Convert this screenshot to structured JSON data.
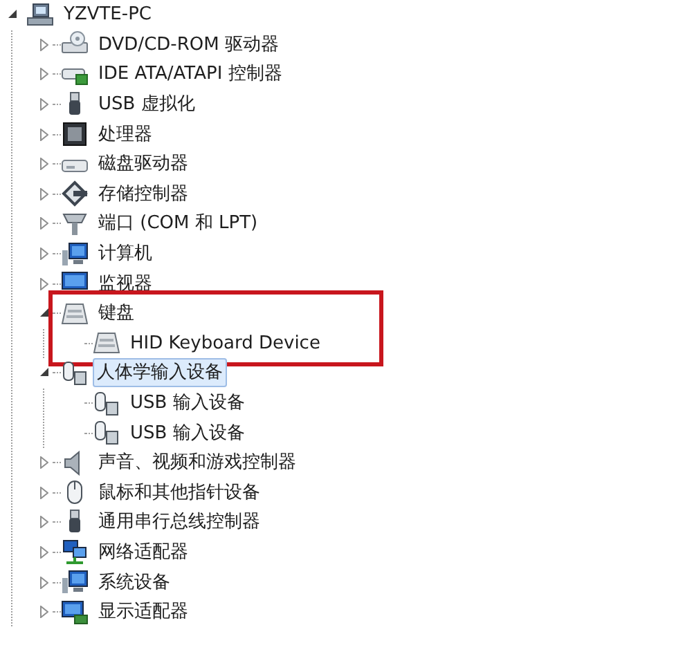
{
  "tree": [
    {
      "label": "YZVTE-PC",
      "expanded": true,
      "selected": false,
      "children": [
        {
          "label": "DVD/CD-ROM 驱动器",
          "expanded": false,
          "selected": false
        },
        {
          "label": "IDE ATA/ATAPI 控制器",
          "expanded": false,
          "selected": false
        },
        {
          "label": "USB 虚拟化",
          "expanded": false,
          "selected": false
        },
        {
          "label": "处理器",
          "expanded": false,
          "selected": false
        },
        {
          "label": "磁盘驱动器",
          "expanded": false,
          "selected": false
        },
        {
          "label": "存储控制器",
          "expanded": false,
          "selected": false
        },
        {
          "label": "端口 (COM 和 LPT)",
          "expanded": false,
          "selected": false
        },
        {
          "label": "计算机",
          "expanded": false,
          "selected": false
        },
        {
          "label": "监视器",
          "expanded": false,
          "selected": false
        },
        {
          "label": "键盘",
          "expanded": true,
          "selected": false,
          "highlighted": true,
          "children": [
            {
              "label": "HID Keyboard Device",
              "selected": false
            }
          ]
        },
        {
          "label": "人体学输入设备",
          "expanded": true,
          "selected": true,
          "children": [
            {
              "label": "USB 输入设备",
              "selected": false
            },
            {
              "label": "USB 输入设备",
              "selected": false
            }
          ]
        },
        {
          "label": "声音、视频和游戏控制器",
          "expanded": false,
          "selected": false
        },
        {
          "label": "鼠标和其他指针设备",
          "expanded": false,
          "selected": false
        },
        {
          "label": "通用串行总线控制器",
          "expanded": false,
          "selected": false
        },
        {
          "label": "网络适配器",
          "expanded": false,
          "selected": false
        },
        {
          "label": "系统设备",
          "expanded": false,
          "selected": false
        },
        {
          "label": "显示适配器",
          "expanded": false,
          "selected": false
        }
      ]
    }
  ]
}
